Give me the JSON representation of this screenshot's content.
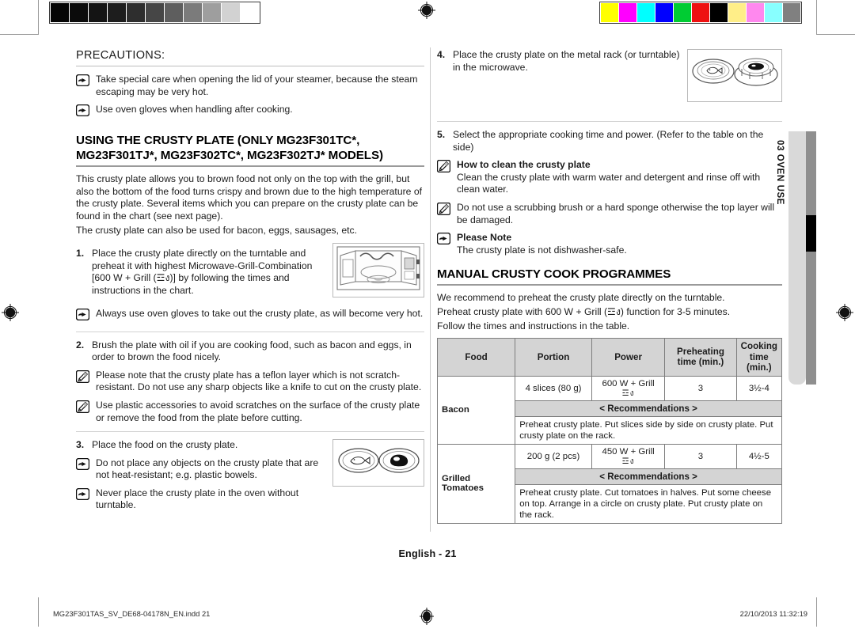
{
  "document": {
    "page_label": "English - 21",
    "file_stamp": "MG23F301TAS_SV_DE68-04178N_EN.indd   21",
    "date_stamp": "22/10/2013   11:32:19",
    "side_tab_label": "03 OVEN USE"
  },
  "calibration": {
    "gray_swatches": [
      "#050505",
      "#0b0b0b",
      "#141414",
      "#1d1d1d",
      "#2e2e2e",
      "#464646",
      "#5e5e5e",
      "#7b7b7b",
      "#9e9e9e",
      "#d2d2d2",
      "#ffffff"
    ],
    "color_swatches": [
      "#ffff00",
      "#ff00ff",
      "#00ffff",
      "#0000ff",
      "#00cc33",
      "#ee1111",
      "#000000",
      "#ffee88",
      "#ff88ee",
      "#88ffff",
      "#808080"
    ]
  },
  "left_column": {
    "precautions_heading": "PRECAUTIONS:",
    "precaution_notes": [
      {
        "icon": "pointing-hand-icon",
        "text": "Take special care when opening the lid of your steamer, because the steam escaping may be very hot."
      },
      {
        "icon": "pointing-hand-icon",
        "text": "Use oven gloves when handling after cooking."
      }
    ],
    "section_heading_line1": "USING THE CRUSTY PLATE (ONLY MG23F301TC*,",
    "section_heading_line2": "MG23F301TJ*, MG23F302TC*, MG23F302TJ* MODELS)",
    "intro_paragraph": "This crusty plate allows you to brown food not only on the top with the grill, but also the bottom of the food turns crispy and brown due to the high temperature of the crusty plate. Several items which you can prepare on the crusty plate can be found in the chart (see next page).",
    "intro_paragraph_2": "The crusty plate can also be used for bacon, eggs, sausages, etc.",
    "steps": [
      {
        "num": "1.",
        "text": "Place the crusty plate directly on the turntable and preheat it with highest Microwave-Grill-Combination [600 W + Grill (☲ง)] by following the times and instructions in the chart.",
        "figure": "microwave-open-door-figure"
      },
      {
        "num": "2.",
        "text": "Brush the plate with oil if you are cooking food, such as bacon and eggs, in order to brown the food nicely."
      },
      {
        "num": "3.",
        "text": "Place the food on the crusty plate.",
        "figure": "fish-and-steak-on-plates-figure"
      }
    ],
    "note_after_step1": {
      "icon": "pointing-hand-icon",
      "text": "Always use oven gloves to take out the crusty plate, as will become very hot."
    },
    "notes_after_step2": [
      {
        "icon": "note-pencil-icon",
        "text": "Please note that the crusty plate has a teflon layer which is not scratch-resistant. Do not use any sharp objects like a knife to cut on the crusty plate."
      },
      {
        "icon": "note-pencil-icon",
        "text": "Use plastic accessories to avoid scratches on the surface of the crusty plate or remove the food from the plate before cutting."
      }
    ],
    "notes_after_step3": [
      {
        "icon": "pointing-hand-icon",
        "text": "Do not place any objects on the crusty plate that are not heat-resistant; e.g. plastic bowels."
      },
      {
        "icon": "pointing-hand-icon",
        "text": "Never place the crusty plate in the oven without turntable."
      }
    ]
  },
  "right_column": {
    "steps": [
      {
        "num": "4.",
        "text": "Place the crusty plate on the metal rack (or turntable) in the microwave.",
        "figure": "plate-on-rack-figure"
      },
      {
        "num": "5.",
        "text": "Select the appropriate cooking time and power. (Refer to the table on the side)"
      }
    ],
    "clean_note": {
      "icon": "note-pencil-icon",
      "title": "How to clean the crusty plate",
      "text": "Clean the crusty plate with warm water and detergent and rinse off with clean water."
    },
    "scrub_note": {
      "icon": "note-pencil-icon",
      "text": "Do not use a scrubbing brush or a hard sponge otherwise the top layer will be damaged."
    },
    "please_note": {
      "icon": "pointing-hand-icon",
      "title": "Please Note",
      "text": "The crusty plate is not dishwasher-safe."
    },
    "programmes_heading": "MANUAL CRUSTY COOK PROGRAMMES",
    "programmes_intro_1": "We recommend to preheat the crusty plate directly on the turntable.",
    "programmes_intro_2": "Preheat crusty plate with 600 W + Grill (☲ง) function for 3-5 minutes.",
    "programmes_intro_3": "Follow the times and instructions in the table."
  },
  "table": {
    "headers": [
      "Food",
      "Portion",
      "Power",
      "Preheating time (min.)",
      "Cooking time (min.)"
    ],
    "header_preheat_l1": "Preheating",
    "header_preheat_l2": "time (min.)",
    "header_cook_l1": "Cooking time",
    "header_cook_l2": "(min.)",
    "recommendations_label": "< Recommendations >",
    "rows": [
      {
        "food": "Bacon",
        "portion": "4 slices (80 g)",
        "power": "600 W + Grill",
        "power_glyph": "☲ง",
        "preheating_time": "3",
        "cooking_time": "3½-4",
        "recommendations": "Preheat crusty plate. Put slices side by side on crusty plate. Put crusty plate on the rack."
      },
      {
        "food": "Grilled Tomatoes",
        "food_l1": "Grilled",
        "food_l2": "Tomatoes",
        "portion": "200 g (2 pcs)",
        "power": "450 W + Grill",
        "power_glyph": "☲ง",
        "preheating_time": "3",
        "cooking_time": "4½-5",
        "recommendations": "Preheat crusty plate. Cut tomatoes in halves. Put some cheese on top. Arrange in a circle on crusty plate. Put crusty plate on the rack."
      }
    ]
  }
}
